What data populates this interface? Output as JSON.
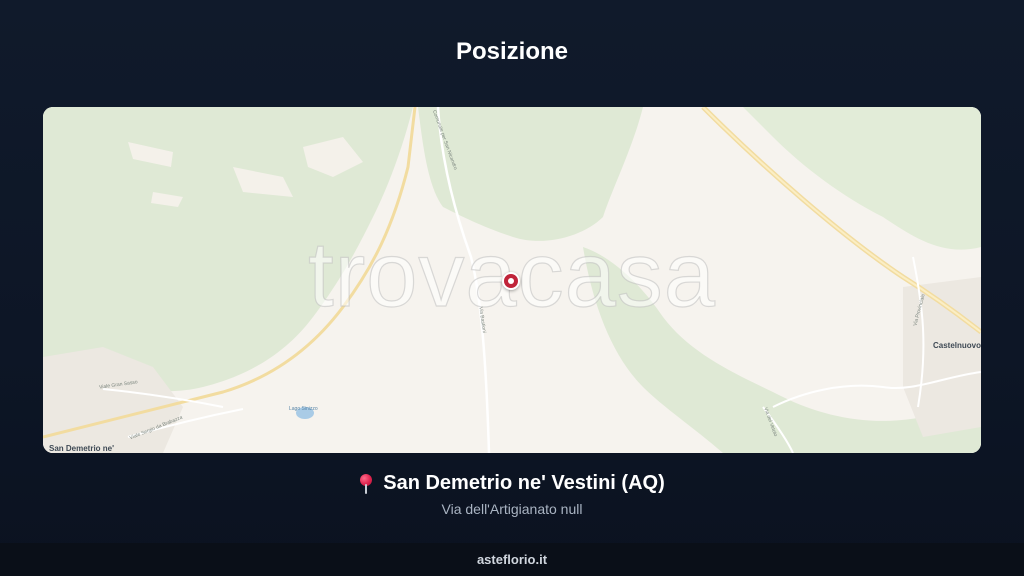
{
  "header": {
    "title": "Posizione"
  },
  "map": {
    "watermark": "trovacasa",
    "labels": {
      "town_left": "San Demetrio ne'",
      "town_right": "Castelnuovo",
      "lake": "Lago Sinizzo",
      "road_1": "Viale Gran Sasso",
      "road_2": "Viale Sergio da Brabazza",
      "road_3": "Via Bastioni",
      "road_4": "Comunale per San Nicandro",
      "road_5": "Via Provinciale",
      "road_6": "Via del Vetoio"
    },
    "colors": {
      "land": "#f6f3ee",
      "forest": "#dfe9d5",
      "road": "#f2dca0",
      "marker": "#c0243a"
    }
  },
  "location": {
    "icon": "round-pushpin-icon",
    "name": "San Demetrio ne' Vestini (AQ)",
    "address": "Via dell'Artigianato null"
  },
  "footer": {
    "brand": "asteflorio.it"
  }
}
